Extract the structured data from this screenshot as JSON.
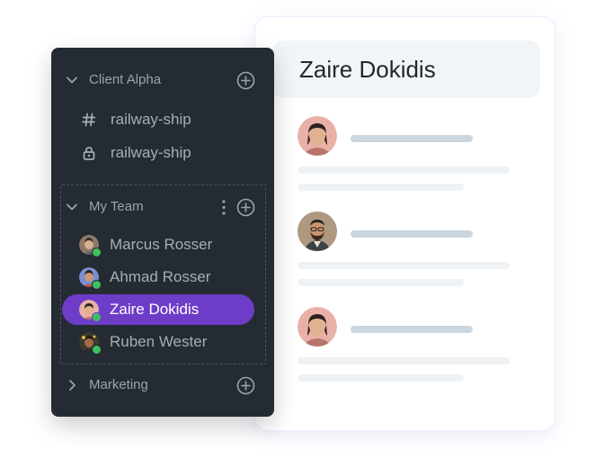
{
  "sidebar": {
    "sections": {
      "client": {
        "label": "Client Alpha",
        "channels": [
          {
            "label": "railway-ship",
            "icon": "hash-icon"
          },
          {
            "label": "railway-ship",
            "icon": "lock-icon"
          }
        ]
      },
      "team": {
        "label": "My Team",
        "members": [
          {
            "name": "Marcus Rosser",
            "status": "online"
          },
          {
            "name": "Ahmad Rosser",
            "status": "online"
          },
          {
            "name": "Zaire Dokidis",
            "status": "online",
            "active": true
          },
          {
            "name": "Ruben Wester",
            "status": "online"
          }
        ]
      },
      "marketing": {
        "label": "Marketing"
      }
    }
  },
  "chat": {
    "title": "Zaire Dokidis",
    "messages": [
      {
        "avatar": "zaire-avatar"
      },
      {
        "avatar": "bearded-man-avatar"
      },
      {
        "avatar": "zaire-avatar"
      }
    ]
  },
  "colors": {
    "sidebar_bg": "#252b33",
    "active_item": "#6d3dc8",
    "presence_online": "#3fbf5f",
    "header_bg": "#f1f5f8",
    "text_placeholder": "#cbd6de"
  }
}
